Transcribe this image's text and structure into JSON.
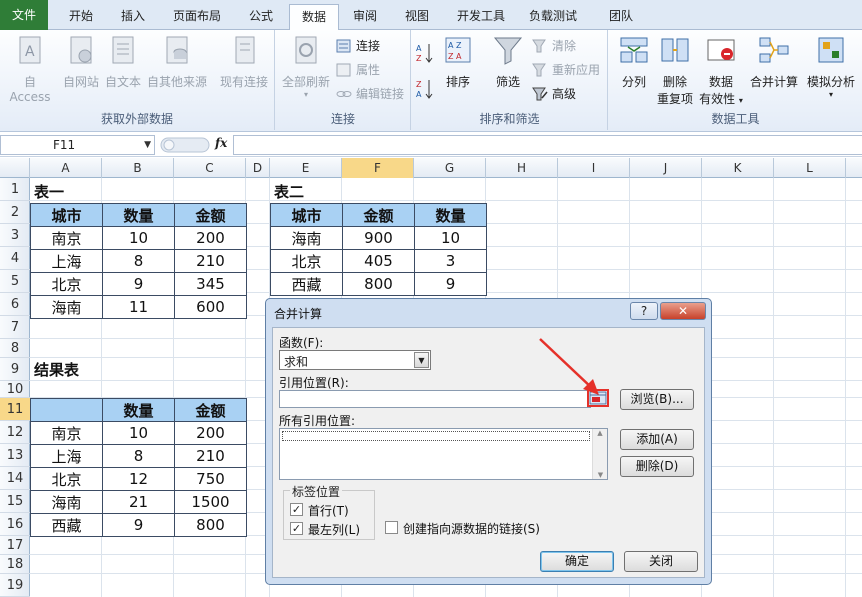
{
  "tabs": [
    "文件",
    "开始",
    "插入",
    "页面布局",
    "公式",
    "数据",
    "审阅",
    "视图",
    "开发工具",
    "负载测试",
    "团队"
  ],
  "ribbon": {
    "external": {
      "label": "获取外部数据",
      "buttons": [
        "自 Access",
        "自网站",
        "自文本",
        "自其他来源",
        "现有连接"
      ]
    },
    "connections": {
      "label": "连接",
      "refresh_all": "全部刷新",
      "items": [
        "连接",
        "属性",
        "编辑链接"
      ]
    },
    "sort_filter": {
      "label": "排序和筛选",
      "sort": "排序",
      "filter": "筛选",
      "items": [
        "清除",
        "重新应用",
        "高级"
      ]
    },
    "data_tools": {
      "label": "数据工具",
      "split": "分列",
      "remove_dup_1": "删除",
      "remove_dup_2": "重复项",
      "validation_1": "数据",
      "validation_2": "有效性",
      "consolidate": "合并计算",
      "whatif": "模拟分析"
    }
  },
  "formula_bar": {
    "name_box": "F11",
    "fx": "fx",
    "value": ""
  },
  "columns": [
    "A",
    "B",
    "C",
    "D",
    "E",
    "F",
    "G",
    "H",
    "I",
    "J",
    "K",
    "L"
  ],
  "rows": [
    "1",
    "2",
    "3",
    "4",
    "5",
    "6",
    "7",
    "8",
    "9",
    "10",
    "11",
    "12",
    "13",
    "14",
    "15",
    "16",
    "17",
    "18",
    "19"
  ],
  "sheet": {
    "table1": {
      "title": "表一",
      "header": [
        "城市",
        "数量",
        "金额"
      ],
      "rows": [
        [
          "南京",
          "10",
          "200"
        ],
        [
          "上海",
          "8",
          "210"
        ],
        [
          "北京",
          "9",
          "345"
        ],
        [
          "海南",
          "11",
          "600"
        ]
      ]
    },
    "table2": {
      "title": "表二",
      "header": [
        "城市",
        "金额",
        "数量"
      ],
      "rows": [
        [
          "海南",
          "900",
          "10"
        ],
        [
          "北京",
          "405",
          "3"
        ],
        [
          "西藏",
          "800",
          "9"
        ]
      ]
    },
    "result": {
      "title": "结果表",
      "header": [
        "",
        "数量",
        "金额"
      ],
      "rows": [
        [
          "南京",
          "10",
          "200"
        ],
        [
          "上海",
          "8",
          "210"
        ],
        [
          "北京",
          "12",
          "750"
        ],
        [
          "海南",
          "21",
          "1500"
        ],
        [
          "西藏",
          "9",
          "800"
        ]
      ]
    }
  },
  "dialog": {
    "title": "合并计算",
    "help": "?",
    "close": "✕",
    "function_label": "函数(F):",
    "function_value": "求和",
    "ref_label": "引用位置(R):",
    "ref_value": "",
    "browse": "浏览(B)...",
    "all_refs_label": "所有引用位置:",
    "add": "添加(A)",
    "delete": "删除(D)",
    "labels_group": "标签位置",
    "first_row": "首行(T)",
    "left_col": "最左列(L)",
    "link_source": "创建指向源数据的链接(S)",
    "ok": "确定",
    "close_btn": "关闭"
  },
  "colors": {
    "header_fill": "#a9d1f3",
    "file_tab": "#2f7d37",
    "selection": "#f8d889",
    "arrow": "#e5312a"
  }
}
